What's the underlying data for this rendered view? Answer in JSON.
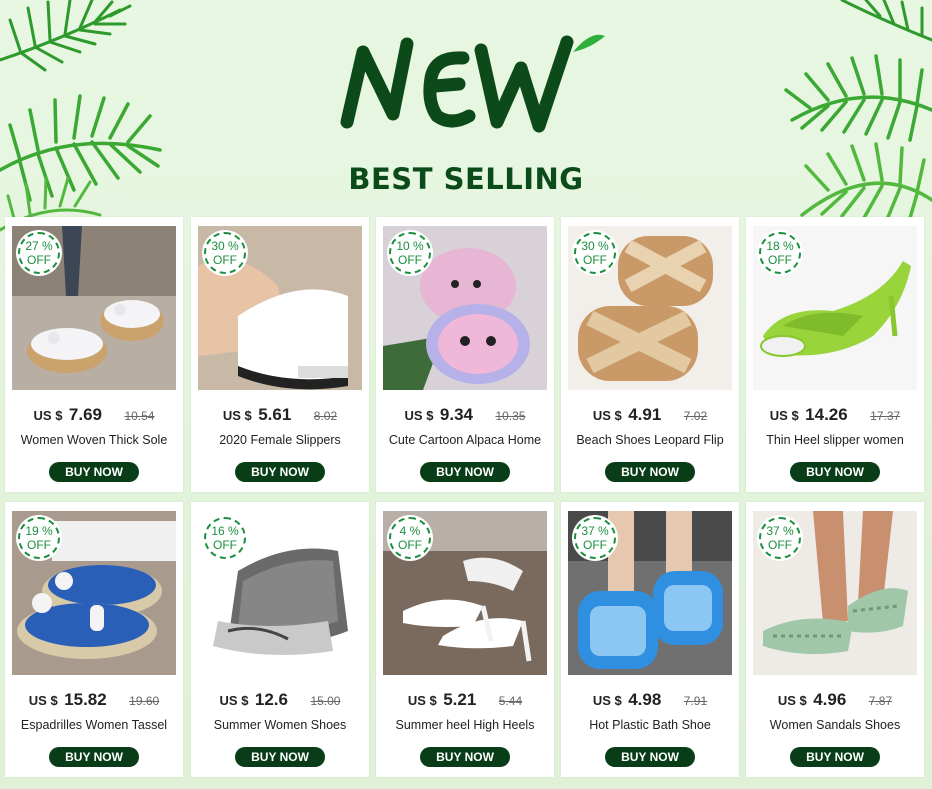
{
  "header": {
    "logo_text": "NEW",
    "subtitle": "BEST SELLING"
  },
  "colors": {
    "brand_green": "#083d18",
    "badge_green": "#1b8f3f",
    "background": "#e4f5dd"
  },
  "products": [
    {
      "discount": "27 %",
      "off": "OFF",
      "currency": "US $",
      "price": "7.69",
      "old_price": "10.54",
      "name": "Women Woven Thick Sole",
      "button": "BUY NOW",
      "icon": "white-platform-sandal"
    },
    {
      "discount": "30 %",
      "off": "OFF",
      "currency": "US $",
      "price": "5.61",
      "old_price": "8.02",
      "name": "2020 Female Slippers",
      "button": "BUY NOW",
      "icon": "white-wedge-slipper"
    },
    {
      "discount": "10 %",
      "off": "OFF",
      "currency": "US $",
      "price": "9.34",
      "old_price": "10.35",
      "name": "Cute Cartoon Alpaca Home",
      "button": "BUY NOW",
      "icon": "alpaca-plush-slipper"
    },
    {
      "discount": "30 %",
      "off": "OFF",
      "currency": "US $",
      "price": "4.91",
      "old_price": "7.02",
      "name": "Beach Shoes Leopard Flip",
      "button": "BUY NOW",
      "icon": "gold-cross-slide"
    },
    {
      "discount": "18 %",
      "off": "OFF",
      "currency": "US $",
      "price": "14.26",
      "old_price": "17.37",
      "name": "Thin Heel slipper women",
      "button": "BUY NOW",
      "icon": "green-heel-mule"
    },
    {
      "discount": "19 %",
      "off": "OFF",
      "currency": "US $",
      "price": "15.82",
      "old_price": "19.60",
      "name": "Espadrilles Women Tassel",
      "button": "BUY NOW",
      "icon": "blue-tassel-espadrille"
    },
    {
      "discount": "16 %",
      "off": "OFF",
      "currency": "US $",
      "price": "12.6",
      "old_price": "15.00",
      "name": "Summer Women Shoes",
      "button": "BUY NOW",
      "icon": "mesh-wedge-mule"
    },
    {
      "discount": "4 %",
      "off": "OFF",
      "currency": "US $",
      "price": "5.21",
      "old_price": "5.44",
      "name": "Summer heel High Heels",
      "button": "BUY NOW",
      "icon": "white-heel-slide"
    },
    {
      "discount": "37 %",
      "off": "OFF",
      "currency": "US $",
      "price": "4.98",
      "old_price": "7.91",
      "name": "Hot Plastic Bath Shoe",
      "button": "BUY NOW",
      "icon": "blue-bath-slipper"
    },
    {
      "discount": "37 %",
      "off": "OFF",
      "currency": "US $",
      "price": "4.96",
      "old_price": "7.87",
      "name": "Women Sandals Shoes",
      "button": "BUY NOW",
      "icon": "mint-slide-sandal"
    }
  ]
}
